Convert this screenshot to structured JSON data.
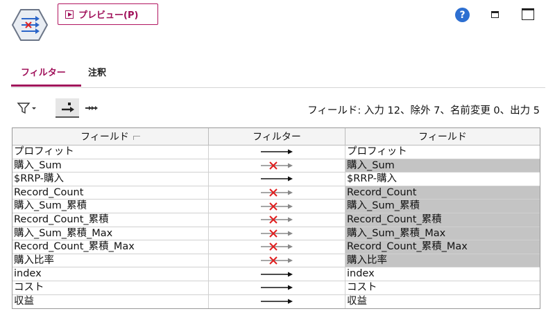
{
  "toolbar": {
    "preview_label": "プレビュー(P)",
    "help_glyph": "?"
  },
  "tabs": [
    {
      "label": "フィルター",
      "active": true
    },
    {
      "label": "注釈",
      "active": false
    }
  ],
  "summary": "フィールド: 入力 12、除外 7、名前変更 0、出力 5",
  "table": {
    "headers": [
      "フィールド",
      "フィルター",
      "フィールド"
    ],
    "rows": [
      {
        "in": "プロフィット",
        "filtered": false,
        "out": "プロフィット"
      },
      {
        "in": "購入_Sum",
        "filtered": true,
        "out": "購入_Sum"
      },
      {
        "in": "$RRP-購入",
        "filtered": false,
        "out": "$RRP-購入"
      },
      {
        "in": "Record_Count",
        "filtered": true,
        "out": "Record_Count"
      },
      {
        "in": "購入_Sum_累積",
        "filtered": true,
        "out": "購入_Sum_累積"
      },
      {
        "in": "Record_Count_累積",
        "filtered": true,
        "out": "Record_Count_累積"
      },
      {
        "in": "購入_Sum_累積_Max",
        "filtered": true,
        "out": "購入_Sum_累積_Max"
      },
      {
        "in": "Record_Count_累積_Max",
        "filtered": true,
        "out": "Record_Count_累積_Max"
      },
      {
        "in": "購入比率",
        "filtered": true,
        "out": "購入比率"
      },
      {
        "in": "index",
        "filtered": false,
        "out": "index"
      },
      {
        "in": "コスト",
        "filtered": false,
        "out": "コスト"
      },
      {
        "in": "収益",
        "filtered": false,
        "out": "収益"
      }
    ]
  },
  "colors": {
    "accent": "#a0105a",
    "excluded_bg": "#c4c4c4",
    "cross": "#e02020",
    "help": "#2d6fd1"
  }
}
